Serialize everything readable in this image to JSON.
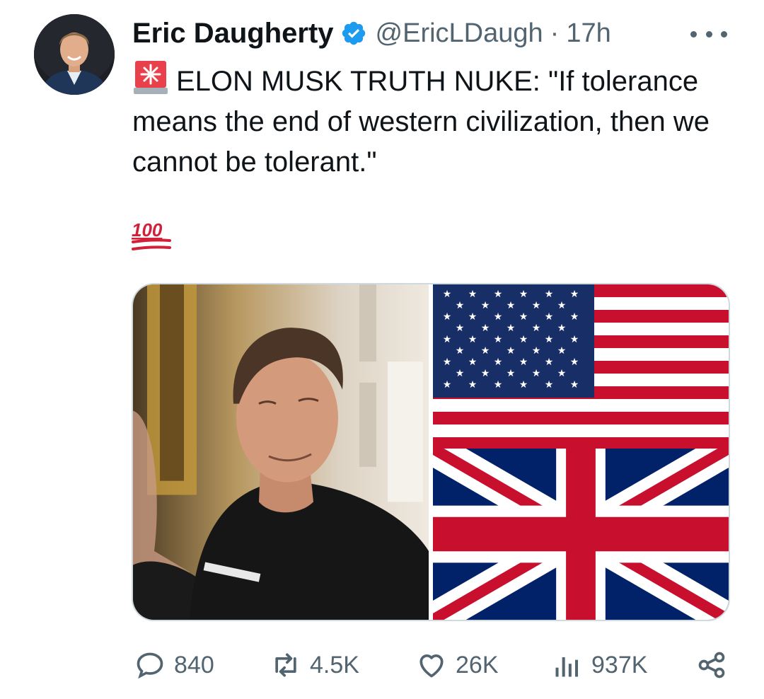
{
  "author": {
    "name": "Eric Daugherty",
    "handle": "@EricLDaugh",
    "separator": "·",
    "time": "17h",
    "verified_color": "#1d9bf0"
  },
  "tweet": {
    "line1_prefix_icon": "police-siren-emoji",
    "text": "ELON MUSK TRUTH NUKE: \"If tolerance means the end of western civilization, then we cannot be tolerant.\"",
    "emoji_icon": "hundred-points-emoji"
  },
  "media": {
    "left_image": "photo-of-man-in-dark-suit",
    "right_top_image": "us-flag",
    "right_bottom_image": "uk-flag"
  },
  "actions": {
    "replies": "840",
    "reposts": "4.5K",
    "likes": "26K",
    "views": "937K"
  },
  "colors": {
    "text": "#0f1419",
    "secondary": "#536471",
    "accent": "#1d9bf0",
    "border": "#cfd9de"
  }
}
